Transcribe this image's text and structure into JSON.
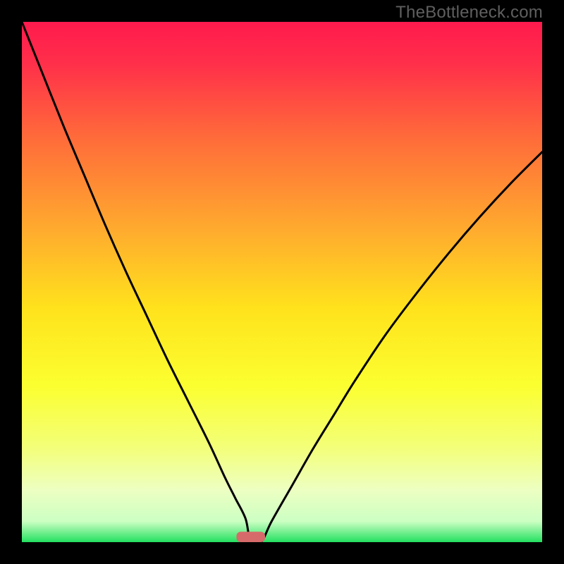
{
  "watermark": "TheBottleneck.com",
  "chart_data": {
    "type": "line",
    "title": "",
    "xlabel": "",
    "ylabel": "",
    "xlim": [
      0,
      100
    ],
    "ylim": [
      0,
      100
    ],
    "background": "red-yellow-green vertical gradient",
    "series": [
      {
        "name": "bottleneck-curve",
        "x": [
          0,
          4,
          8,
          12,
          16,
          20,
          24,
          28,
          32,
          36,
          39,
          41,
          43,
          44,
          46,
          48,
          52,
          56,
          60,
          64,
          70,
          76,
          82,
          88,
          94,
          100
        ],
        "values": [
          100,
          90,
          80,
          70.5,
          61,
          52,
          43.5,
          35,
          27,
          19,
          12.5,
          8.5,
          4.5,
          0,
          0,
          4,
          11,
          18,
          24.5,
          31,
          40,
          48,
          55.5,
          62.5,
          69,
          75
        ]
      }
    ],
    "marker": {
      "x": 44,
      "y": 0,
      "width": 5.5,
      "height": 2,
      "color": "#d66a6a"
    },
    "gradient_stops": [
      {
        "offset": 0,
        "color": "#ff1a4d"
      },
      {
        "offset": 0.08,
        "color": "#ff2f4a"
      },
      {
        "offset": 0.22,
        "color": "#ff6a3a"
      },
      {
        "offset": 0.4,
        "color": "#ffab2e"
      },
      {
        "offset": 0.55,
        "color": "#ffe21c"
      },
      {
        "offset": 0.7,
        "color": "#fbff30"
      },
      {
        "offset": 0.82,
        "color": "#f3ff7a"
      },
      {
        "offset": 0.9,
        "color": "#edffc2"
      },
      {
        "offset": 0.96,
        "color": "#ccffc3"
      },
      {
        "offset": 1.0,
        "color": "#23e060"
      }
    ]
  }
}
